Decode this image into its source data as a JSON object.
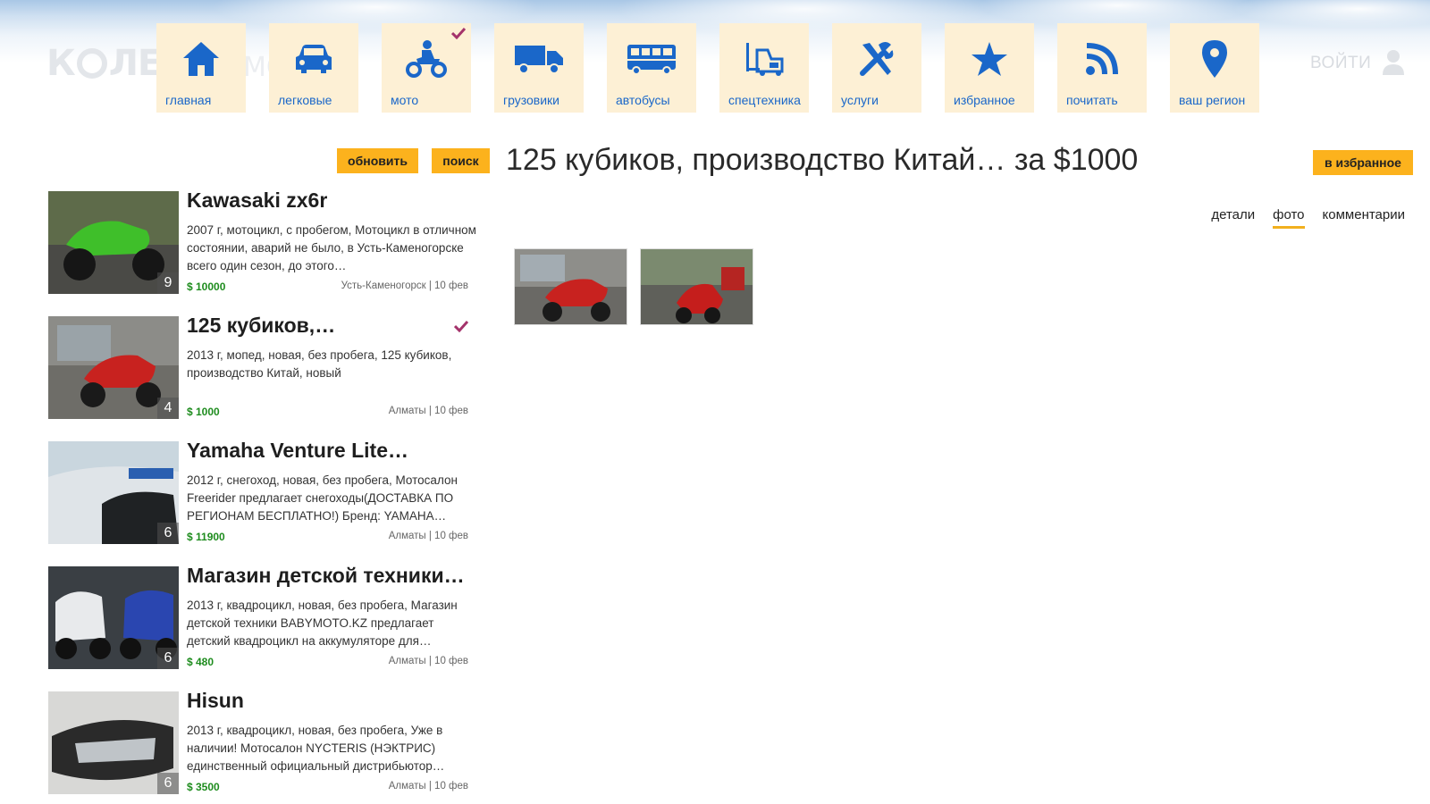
{
  "logo": {
    "text_left": "К",
    "text_right": "ЛЕ",
    "tail": "МО"
  },
  "nav": [
    {
      "label": "главная",
      "icon": "home-icon"
    },
    {
      "label": "легковые",
      "icon": "car-icon"
    },
    {
      "label": "мото",
      "icon": "motorcycle-icon",
      "selected": true
    },
    {
      "label": "грузовики",
      "icon": "truck-icon"
    },
    {
      "label": "автобусы",
      "icon": "bus-icon"
    },
    {
      "label": "спецтехника",
      "icon": "forklift-icon"
    },
    {
      "label": "услуги",
      "icon": "tools-icon"
    },
    {
      "label": "избранное",
      "icon": "star-icon"
    },
    {
      "label": "почитать",
      "icon": "rss-icon"
    },
    {
      "label": "ваш регион",
      "icon": "location-pin-icon"
    }
  ],
  "header": {
    "login_label": "ВОЙТИ"
  },
  "toolbar": {
    "refresh_label": "обновить",
    "search_label": "поиск",
    "favorite_label": "в избранное"
  },
  "listings": [
    {
      "title": "Kawasaki zx6r",
      "description": "2007 г, мотоцикл, с пробегом, Мотоцикл в отличном состоянии, аварий не было, в Усть-Каменогорске всего один сезон, до этого…",
      "price": "$ 10000",
      "meta": "Усть-Каменогорск | 10 фев",
      "photo_count": "9",
      "checked": false
    },
    {
      "title": "125 кубиков,…",
      "description": "2013 г, мопед, новая, без пробега, 125 кубиков, производство Китай, новый",
      "price": "$ 1000",
      "meta": "Алматы | 10 фев",
      "photo_count": "4",
      "checked": true
    },
    {
      "title": "Yamaha Venture Lite…",
      "description": "2012 г, снегоход, новая, без пробега, Мотосалон Freerider предлагает снегоходы(ДОСТАВКА ПО РЕГИОНАМ БЕСПЛАТНО!) Бренд: YAMAHA…",
      "price": "$ 11900",
      "meta": "Алматы | 10 фев",
      "photo_count": "6",
      "checked": false
    },
    {
      "title": "Магазин детской техники…",
      "description": "2013 г, квадроцикл, новая, без пробега, Магазин детской техники BABYMOTO.KZ предлагает детский квадроцикл на аккумуляторе для…",
      "price": "$ 480",
      "meta": "Алматы | 10 фев",
      "photo_count": "6",
      "checked": false
    },
    {
      "title": "Hisun",
      "description": "2013 г, квадроцикл, новая, без пробега, Уже в наличии! Мотосалон NYCTERIS (НЭКТРИС) единственный официальный дистрибьютор…",
      "price": "$ 3500",
      "meta": "Алматы | 10 фев",
      "photo_count": "6",
      "checked": false
    }
  ],
  "detail": {
    "title": "125 кубиков, производство Китай… за $1000",
    "tabs": [
      {
        "label": "детали",
        "active": false
      },
      {
        "label": "фото",
        "active": true
      },
      {
        "label": "комментарии",
        "active": false
      }
    ]
  },
  "colors": {
    "accent": "#fcb21d",
    "nav_tile": "#fdf0d5",
    "nav_icon": "#1a67c9",
    "price": "#1e8c1e",
    "check": "#a4336b"
  }
}
